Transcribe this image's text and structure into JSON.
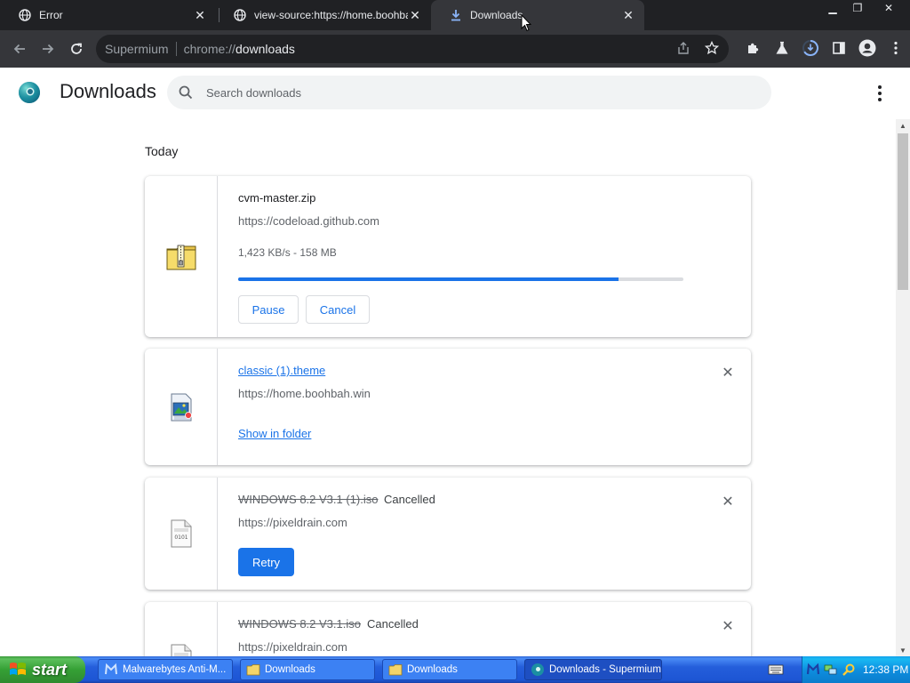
{
  "tabs": [
    {
      "title": "Error",
      "icon": "globe-icon"
    },
    {
      "title": "view-source:https://home.boohbah",
      "icon": "globe-icon"
    },
    {
      "title": "Downloads",
      "icon": "download-icon",
      "active": true
    }
  ],
  "window_controls": {
    "minimize": "▁",
    "restore": "❐",
    "close": "✕"
  },
  "toolbar": {
    "brand": "Supermium",
    "url_scheme": "chrome://",
    "url_path": "downloads"
  },
  "page": {
    "title": "Downloads",
    "search_placeholder": "Search downloads"
  },
  "downloads": {
    "date_header": "Today",
    "items": [
      {
        "name": "cvm-master.zip",
        "url": "https://codeload.github.com",
        "progress_text": "1,423 KB/s - 158 MB",
        "progress_fraction": 0.855,
        "pause_label": "Pause",
        "cancel_label": "Cancel",
        "icon": "zip-file-icon"
      },
      {
        "name": "classic (1).theme",
        "url": "https://home.boohbah.win",
        "show_folder_label": "Show in folder",
        "icon": "theme-file-icon"
      },
      {
        "name": "WINDOWS 8.2 V3.1 (1).iso",
        "status": "Cancelled",
        "url": "https://pixeldrain.com",
        "retry_label": "Retry",
        "icon": "generic-file-icon"
      },
      {
        "name": "WINDOWS 8.2 V3.1.iso",
        "status": "Cancelled",
        "url": "https://pixeldrain.com",
        "icon": "generic-file-icon"
      }
    ]
  },
  "taskbar": {
    "start_label": "start",
    "items": [
      {
        "label": "Malwarebytes Anti-M...",
        "icon": "malwarebytes-icon"
      },
      {
        "label": "Downloads",
        "icon": "folder-icon"
      },
      {
        "label": "Downloads",
        "icon": "folder-icon"
      },
      {
        "label": "Downloads - Supermium",
        "icon": "supermium-icon",
        "active": true
      }
    ],
    "clock": "12:38 PM"
  },
  "colors": {
    "accent": "#1a73e8",
    "tab_strip": "#202124",
    "toolbar": "#35363a"
  }
}
